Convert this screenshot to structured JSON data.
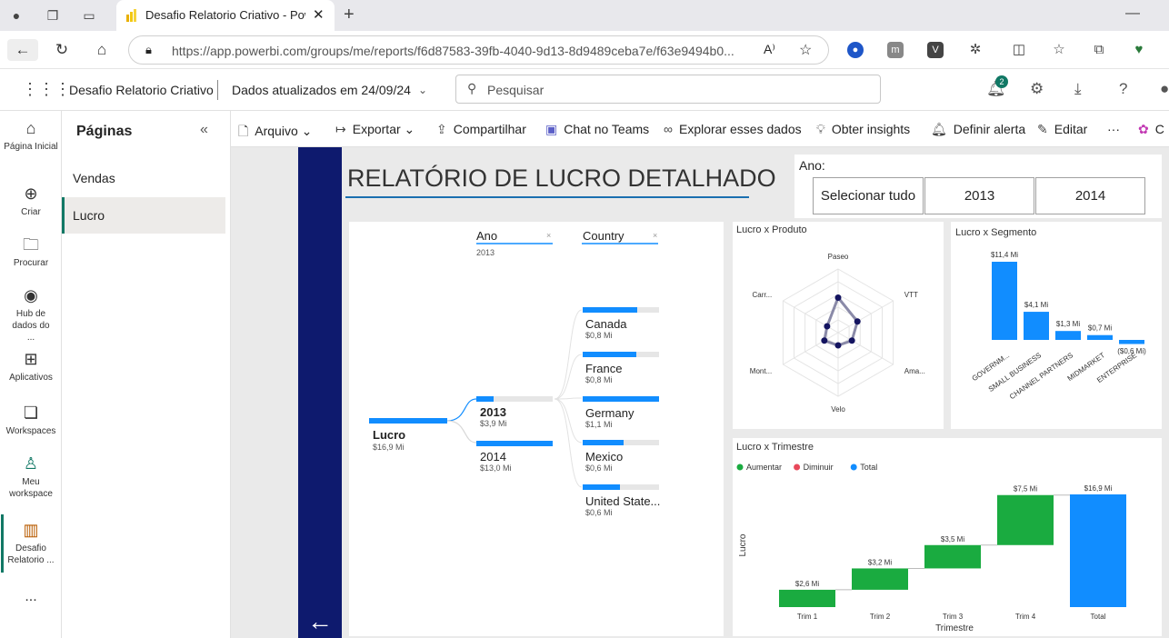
{
  "browser": {
    "tab_title": "Desafio Relatorio Criativo - Power BI",
    "tab_close": "✕",
    "new_tab": "+",
    "url": "https://app.powerbi.com/groups/me/reports/f6d87583-39fb-4040-9d13-8d9489ceba7e/f63e9494b0...",
    "minimize": "—"
  },
  "header": {
    "workspace_title": "Desafio Relatorio Criativo",
    "updated": "Dados atualizados em 24/09/24",
    "search_placeholder": "Pesquisar",
    "notification_count": "2"
  },
  "rail": {
    "items": [
      {
        "label": "Página Inicial",
        "icon": "home-icon"
      },
      {
        "label": "Criar",
        "icon": "plus-circle-icon"
      },
      {
        "label": "Procurar",
        "icon": "folder-icon"
      },
      {
        "label": "Hub de dados do ...",
        "icon": "data-hub-icon"
      },
      {
        "label": "Aplicativos",
        "icon": "apps-icon"
      },
      {
        "label": "Workspaces",
        "icon": "workspaces-icon"
      },
      {
        "label": "Meu workspace",
        "icon": "person-icon"
      },
      {
        "label": "Desafio Relatorio ...",
        "icon": "report-icon"
      }
    ],
    "more": "..."
  },
  "pages_pane": {
    "title": "Páginas",
    "pages": [
      {
        "label": "Vendas",
        "active": false
      },
      {
        "label": "Lucro",
        "active": true
      }
    ]
  },
  "toolbar": {
    "file": "Arquivo",
    "export": "Exportar",
    "share": "Compartilhar",
    "teams": "Chat no Teams",
    "explore": "Explorar esses dados",
    "insights": "Obter insights",
    "alert": "Definir alerta",
    "edit": "Editar",
    "more": "···",
    "copilot": "C"
  },
  "report": {
    "title": "RELATÓRIO DE LUCRO DETALHADO",
    "slicer": {
      "label": "Ano:",
      "options": [
        "Selecionar tudo",
        "2013",
        "2014"
      ]
    }
  },
  "decomposition_tree": {
    "headers": {
      "level1": "Ano",
      "level1_filter": "2013",
      "level2": "Country"
    },
    "root": {
      "label": "Lucro",
      "value": "$16,9 Mi"
    },
    "years": [
      {
        "label": "2013",
        "value": "$3,9 Mi",
        "share": 0.23,
        "selected": true
      },
      {
        "label": "2014",
        "value": "$13,0 Mi",
        "share": 1.0,
        "selected": false
      }
    ],
    "countries": [
      {
        "label": "Canada",
        "value": "$0,8 Mi",
        "share": 0.71
      },
      {
        "label": "France",
        "value": "$0,8 Mi",
        "share": 0.7
      },
      {
        "label": "Germany",
        "value": "$1,1 Mi",
        "share": 1.0
      },
      {
        "label": "Mexico",
        "value": "$0,6 Mi",
        "share": 0.54
      },
      {
        "label": "United State...",
        "value": "$0,6 Mi",
        "share": 0.49
      }
    ]
  },
  "chart_data": [
    {
      "type": "radar",
      "title": "Lucro x Produto",
      "categories": [
        "Paseo",
        "VTT",
        "Ama...",
        "Velo",
        "Mont...",
        "Carr..."
      ],
      "values": [
        0.55,
        0.35,
        0.25,
        0.2,
        0.25,
        0.2
      ],
      "colors": {
        "series": "#8a8aa8",
        "points": "#141460"
      }
    },
    {
      "type": "bar",
      "title": "Lucro x Segmento",
      "categories": [
        "GOVERNM...",
        "SMALL BUSINESS",
        "CHANNEL PARTNERS",
        "MIDMARKET",
        "ENTERPRISE"
      ],
      "values": [
        11.4,
        4.1,
        1.3,
        0.7,
        -0.6
      ],
      "labels": [
        "$11,4 Mi",
        "$4,1 Mi",
        "$1,3 Mi",
        "$0,7 Mi",
        "($0,6 Mi)"
      ],
      "color": "#118dff"
    },
    {
      "type": "waterfall",
      "title": "Lucro x Trimestre",
      "legend": [
        "Aumentar",
        "Diminuir",
        "Total"
      ],
      "legend_colors": [
        "#1aab40",
        "#e8485a",
        "#118dff"
      ],
      "xlabel": "Trimestre",
      "ylabel": "Lucro",
      "categories": [
        "Trim 1",
        "Trim 2",
        "Trim 3",
        "Trim 4",
        "Total"
      ],
      "values": [
        2.6,
        3.2,
        3.5,
        7.5,
        16.9
      ],
      "labels": [
        "$2,6 Mi",
        "$3,2 Mi",
        "$3,5 Mi",
        "$7,5 Mi",
        "$16,9 Mi"
      ]
    }
  ]
}
